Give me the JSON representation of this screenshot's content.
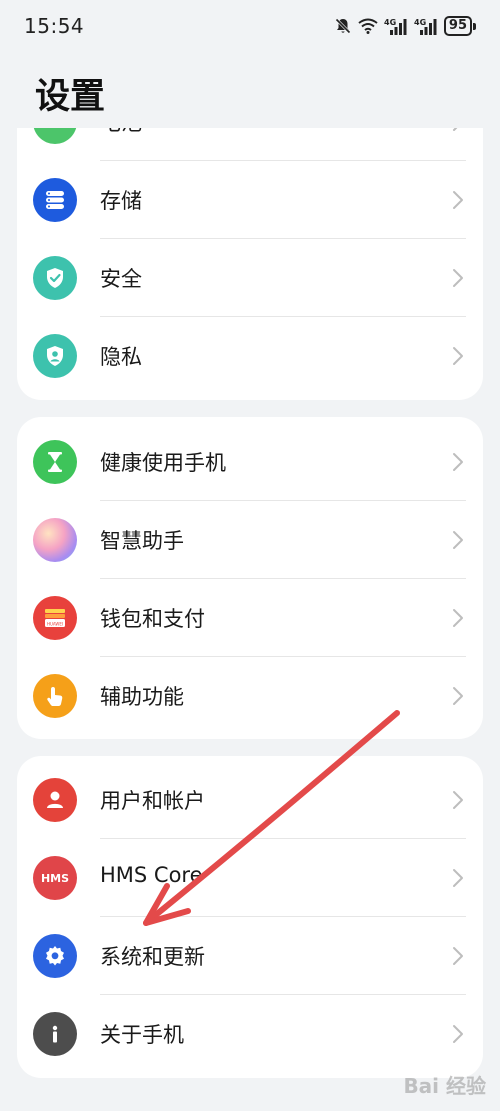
{
  "status_bar": {
    "time": "15:54",
    "network_1": "4G",
    "network_2": "4G",
    "battery": "95"
  },
  "page": {
    "title": "设置"
  },
  "groups": [
    {
      "items": [
        {
          "label": "电池",
          "icon": "battery-icon",
          "color": "#4cc56a"
        },
        {
          "label": "存储",
          "icon": "storage-icon",
          "color": "#1e5bde"
        },
        {
          "label": "安全",
          "icon": "shield-check-icon",
          "color": "#3dc2ad"
        },
        {
          "label": "隐私",
          "icon": "privacy-icon",
          "color": "#3dc2ad"
        }
      ]
    },
    {
      "items": [
        {
          "label": "健康使用手机",
          "icon": "hourglass-icon",
          "color": "#3ec45a"
        },
        {
          "label": "智慧助手",
          "icon": "assistant-orb-icon",
          "color": "#c7a4ef"
        },
        {
          "label": "钱包和支付",
          "icon": "wallet-icon",
          "color": "#e8413c"
        },
        {
          "label": "辅助功能",
          "icon": "hand-pointer-icon",
          "color": "#f5a019"
        }
      ]
    },
    {
      "items": [
        {
          "label": "用户和帐户",
          "icon": "user-icon",
          "color": "#e4433a"
        },
        {
          "label": "HMS Core",
          "icon": "hms-icon",
          "color": "#e04549"
        },
        {
          "label": "系统和更新",
          "icon": "gear-icon",
          "color": "#2c63e0"
        },
        {
          "label": "关于手机",
          "icon": "info-icon",
          "color": "#4d4d4d"
        }
      ]
    }
  ],
  "icon_text": {
    "hms": "HMS",
    "wallet": "HUAWEI"
  },
  "annotation": {
    "arrow_color": "#e34a4a"
  },
  "watermark": "Bai 经验"
}
